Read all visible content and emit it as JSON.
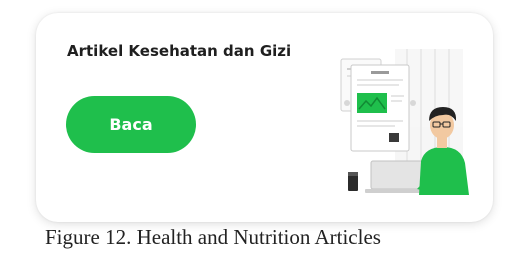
{
  "card": {
    "title": "Artikel Kesehatan dan Gizi",
    "button_label": "Baca",
    "illustration": "person-reading-articles-on-laptop"
  },
  "caption": "Figure 12. Health and Nutrition Articles",
  "colors": {
    "accent": "#1fbf4c",
    "title_text": "#1f1f1f",
    "card_background": "#ffffff"
  }
}
